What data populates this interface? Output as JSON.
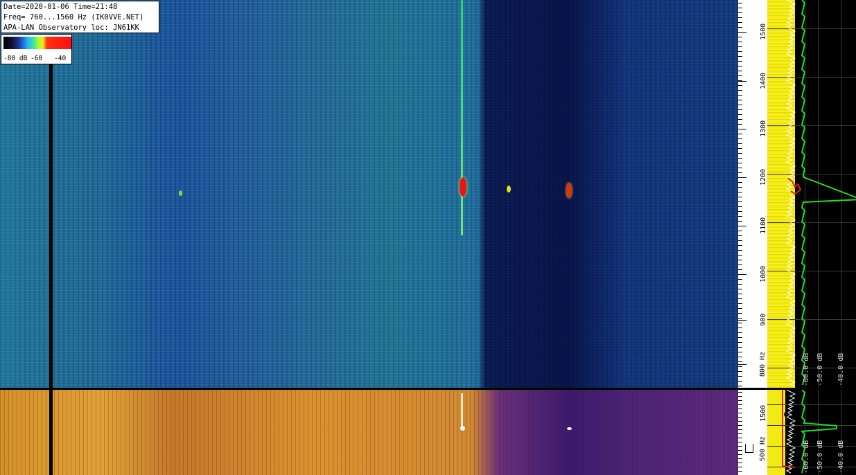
{
  "info": {
    "line1": "Date=2020-01-06 Time=21:48",
    "line2": "Freq= 760...1560 Hz (IK0VVE.NET)",
    "line3": "APA-LAN Observatory loc: JN61KK"
  },
  "scale": {
    "label_min": "-80 dB",
    "label_mid": "-60",
    "label_max": "-40"
  },
  "freq_axis_top": {
    "labels": [
      "1500",
      "1400",
      "1300",
      "1200",
      "1100",
      "1000",
      "900",
      "800 Hz"
    ]
  },
  "freq_axis_bottom": {
    "labels": [
      "1500",
      "500 Hz"
    ]
  },
  "spectrum_top": {
    "labels": [
      "-60.0 dB",
      "-50.0 dB",
      "-40.0 dB"
    ]
  },
  "spectrum_bottom": {
    "labels": [
      "-60.0 dB",
      "-50.0 dB",
      "-40.0 dB"
    ]
  },
  "colors": {
    "trace_green": "#22e022",
    "trace_red": "#e02020",
    "band_yellow": "#f2ea12"
  }
}
